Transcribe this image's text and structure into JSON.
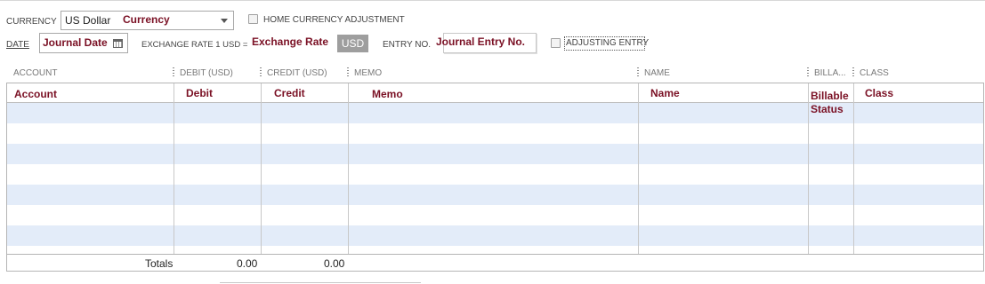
{
  "header": {
    "currency_label": "CURRENCY",
    "currency_value": "US Dollar",
    "currency_hint": "Currency",
    "home_currency_label": "HOME CURRENCY ADJUSTMENT",
    "date_label": "DATE",
    "date_hint": "Journal Date",
    "exchange_rate_label": "EXCHANGE RATE 1 USD =",
    "exchange_rate_hint": "Exchange Rate",
    "exchange_rate_unit": "USD",
    "entry_no_label": "ENTRY NO.",
    "entry_no_hint": "Journal Entry No.",
    "adjusting_label": "ADJUSTING ENTRY"
  },
  "columns": [
    {
      "header": "ACCOUNT",
      "hint": "Account"
    },
    {
      "header": "DEBIT (USD)",
      "hint": "Debit"
    },
    {
      "header": "CREDIT (USD)",
      "hint": "Credit"
    },
    {
      "header": "MEMO",
      "hint": "Memo"
    },
    {
      "header": "NAME",
      "hint": "Name"
    },
    {
      "header": "BILLA...",
      "hint": "Billable Status"
    },
    {
      "header": "CLASS",
      "hint": "Class"
    }
  ],
  "totals": {
    "label": "Totals",
    "debit": "0.00",
    "credit": "0.00"
  }
}
